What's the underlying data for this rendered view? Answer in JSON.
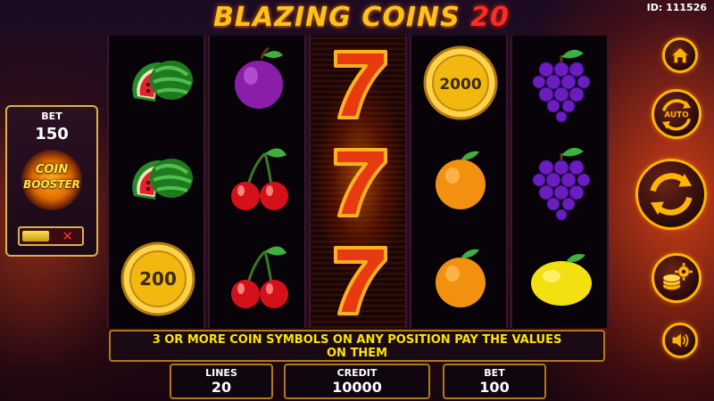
{
  "game": {
    "title_main": "BLAZING COINS",
    "title_number": "20",
    "id_text": "ID: 111526"
  },
  "reels": [
    [
      "watermelon",
      "watermelon",
      "coin"
    ],
    [
      "plum",
      "cherries",
      "cherries"
    ],
    [
      "seven",
      "seven",
      "seven"
    ],
    [
      "coin",
      "orange",
      "orange"
    ],
    [
      "grapes",
      "grapes",
      "lemon"
    ]
  ],
  "coin_values": {
    "r0c2": "200",
    "r3c0": "2000"
  },
  "bet_panel": {
    "label": "BET",
    "value": "150",
    "booster_line1": "COIN",
    "booster_line2": "BOOSTER",
    "toggle_off_glyph": "✕"
  },
  "message": {
    "line1": "3 OR MORE COIN SYMBOLS ON ANY POSITION PAY THE VALUES",
    "line2": "ON THEM"
  },
  "stats": {
    "lines_label": "LINES",
    "lines_value": "20",
    "credit_label": "CREDIT",
    "credit_value": "10000",
    "bet_label": "BET",
    "bet_value": "100"
  },
  "controls": {
    "auto_label": "AUTO",
    "icons": [
      "home-icon",
      "auto-spin-icon",
      "spin-icon",
      "coins-settings-icon",
      "sound-icon"
    ]
  },
  "colors": {
    "accent_gold": "#ffb400",
    "title_yellow": "#ffc21a",
    "title_red": "#ff2a2a",
    "message_yellow": "#ffe400"
  }
}
